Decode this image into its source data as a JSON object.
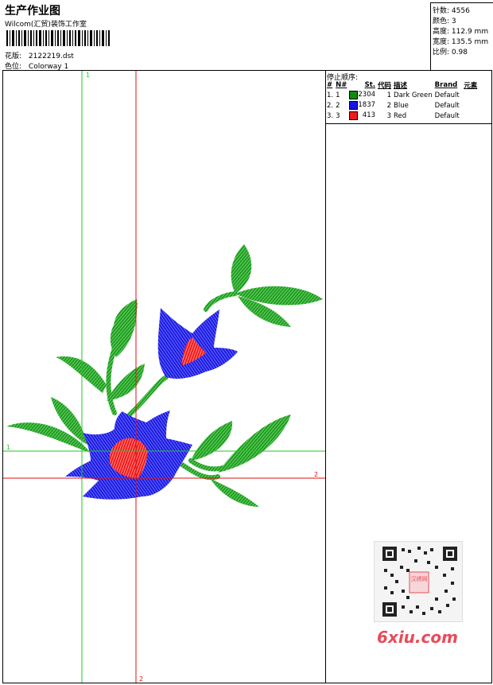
{
  "header": {
    "title": "生产作业图",
    "company": "Wilcom(汇贸)装饰工作室",
    "design_label": "花版:",
    "design_value": "2122219.dst",
    "colorway_label": "色位:",
    "colorway_value": "Colorway 1"
  },
  "stats": {
    "stitches_label": "针数:",
    "stitches_value": "4556",
    "colors_label": "颜色:",
    "colors_value": "3",
    "height_label": "高度:",
    "height_value": "112.9 mm",
    "width_label": "宽度:",
    "width_value": "135.5 mm",
    "ratio_label": "比例:",
    "ratio_value": "0.98"
  },
  "stop_sequence": {
    "title": "停止顺序:",
    "headers": [
      "#",
      "N#",
      "St.",
      "代码",
      "描述",
      "Brand",
      "元素"
    ],
    "rows": [
      {
        "idx": "1.",
        "n": "1",
        "st": "2304",
        "code": "1",
        "desc": "Dark Green",
        "brand": "Default",
        "color": "#0f8a12"
      },
      {
        "idx": "2.",
        "n": "2",
        "st": "1837",
        "code": "2",
        "desc": "Blue",
        "brand": "Default",
        "color": "#1414e6"
      },
      {
        "idx": "3.",
        "n": "3",
        "st": "413",
        "code": "3",
        "desc": "Red",
        "brand": "Default",
        "color": "#ee1c1c"
      }
    ]
  },
  "guides": {
    "green_vertical_label": "1",
    "green_horizontal_label": "1",
    "red_vertical_label": "2",
    "red_horizontal_label": "2"
  },
  "colors": {
    "green_thread": "#1f9a1f",
    "blue_thread": "#1a1ae0",
    "red_thread": "#f01a1a",
    "guide_green": "#23c423",
    "guide_red": "#e01010"
  },
  "watermark": {
    "qr_caption": "汉绣网",
    "site": "6xiu.com"
  }
}
